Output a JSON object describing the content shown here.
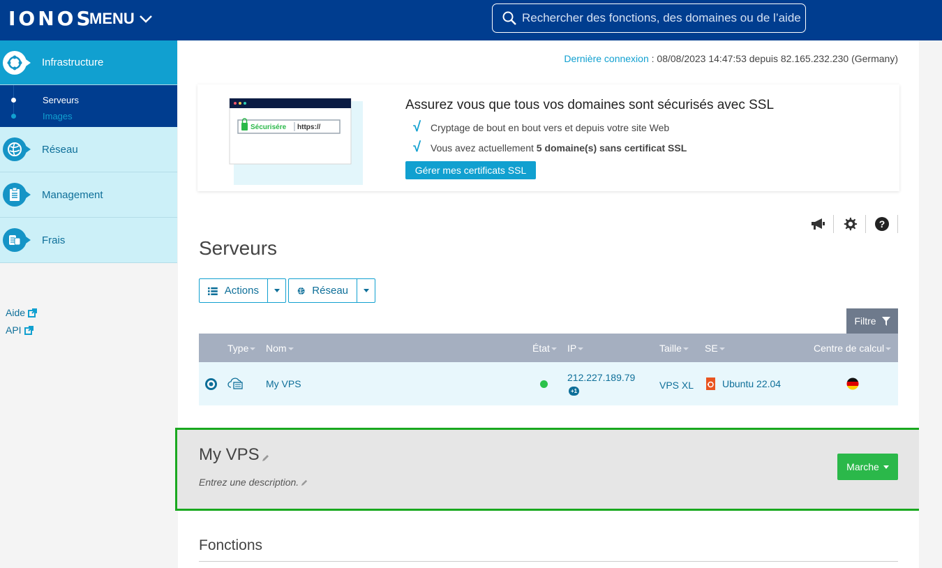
{
  "header": {
    "logo": "IONOS",
    "menu_label": "MENU",
    "search_placeholder": "Rechercher des fonctions, des domaines ou de l’aide"
  },
  "sidebar": {
    "categories": [
      {
        "label": "Infrastructure",
        "icon": "infrastructure-icon"
      },
      {
        "label": "Réseau",
        "icon": "network-globe-icon"
      },
      {
        "label": "Management",
        "icon": "clipboard-icon"
      },
      {
        "label": "Frais",
        "icon": "coins-icon"
      }
    ],
    "sub_items": [
      {
        "label": "Serveurs"
      },
      {
        "label": "Images"
      }
    ],
    "links": [
      {
        "label": "Aide"
      },
      {
        "label": "API"
      }
    ]
  },
  "last_connection": {
    "link_label": "Dernière connexion",
    "text": " : 08/08/2023 14:47:53 depuis 82.165.232.230 (Germany)"
  },
  "ssl_banner": {
    "title": "Assurez vous que tous vos domaines sont sécurisés avec SSL",
    "bullet_1": "Cryptage de bout en bout vers et depuis votre site Web",
    "bullet_2_prefix": "Vous avez actuellement ",
    "bullet_2_bold": "5 domaine(s) sans certificat SSL",
    "button_label": "Gérer mes certificats SSL",
    "illustration_secure": "Sécurisére",
    "illustration_https": "https://"
  },
  "page": {
    "title": "Serveurs",
    "actions_label": "Actions",
    "network_label": "Réseau",
    "filter_label": "Filtre"
  },
  "table": {
    "headers": {
      "type": "Type",
      "name": "Nom",
      "state": "État",
      "ip": "IP",
      "size": "Taille",
      "os": "SE",
      "datacenter": "Centre de calcul"
    },
    "rows": [
      {
        "name": "My VPS",
        "state_color": "#2bc24a",
        "ip": "212.227.189.79",
        "ip_extra": "+1",
        "size": "VPS XL",
        "os": "Ubuntu 22.04",
        "datacenter_flag": "germany-flag-icon"
      }
    ]
  },
  "detail": {
    "name": "My VPS",
    "description_placeholder": "Entrez une description.",
    "status_button": "Marche"
  },
  "functions": {
    "title": "Fonctions"
  },
  "colors": {
    "topbar": "#003d8f",
    "accent": "#11a0d0",
    "highlight_border": "#19a81f",
    "run_button": "#2bb84a"
  }
}
